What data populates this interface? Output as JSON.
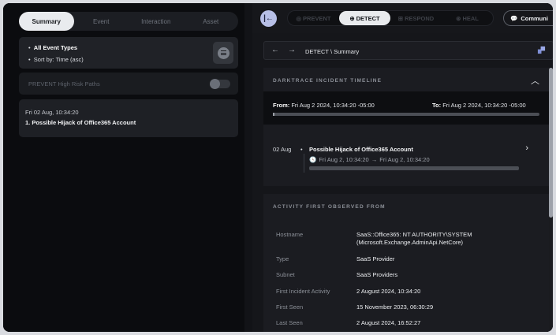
{
  "left_panel": {
    "tabs": [
      {
        "label": "Summary",
        "active": true
      },
      {
        "label": "Event",
        "active": false
      },
      {
        "label": "Interaction",
        "active": false
      },
      {
        "label": "Asset",
        "active": false
      }
    ],
    "filters": {
      "event_types": "All Event Types",
      "sort": "Sort by: Time (asc)",
      "filter_icon": "filter-list-icon"
    },
    "prevent_row": {
      "label": "PREVENT High Risk Paths",
      "enabled": false
    },
    "incident": {
      "date": "Fri 02 Aug, 10:34:20",
      "title": "1. Possible Hijack of Office365 Account"
    }
  },
  "right_panel": {
    "collapse_icon": "collapse-panel-icon",
    "modes": [
      {
        "label": "PREVENT",
        "icon": "prevent-icon",
        "active": false
      },
      {
        "label": "DETECT",
        "icon": "detect-icon",
        "active": true
      },
      {
        "label": "RESPOND",
        "icon": "respond-icon",
        "active": false
      },
      {
        "label": "HEAL",
        "icon": "heal-icon",
        "active": false
      }
    ],
    "communicate_label": "Communi",
    "breadcrumb": "DETECT \\ Summary",
    "timeline": {
      "title": "DARKTRACE INCIDENT TIMELINE",
      "from_label": "From:",
      "from_value": "Fri Aug 2 2024, 10:34:20 -05:00",
      "to_label": "To:",
      "to_value": "Fri Aug 2 2024, 10:34:20 -05:00",
      "event": {
        "date": "02 Aug",
        "title": "Possible Hijack of Office365 Account",
        "start": "Fri Aug 2, 10:34:20",
        "end": "Fri Aug 2, 10:34:20"
      }
    },
    "activity": {
      "title": "ACTIVITY FIRST OBSERVED FROM",
      "rows": [
        {
          "key": "Hostname",
          "value": "SaaS::Office365: NT AUTHORITY\\SYSTEM (Microsoft.Exchange.AdminApi.NetCore)"
        },
        {
          "key": "Type",
          "value": "SaaS Provider"
        },
        {
          "key": "Subnet",
          "value": "SaaS Providers"
        },
        {
          "key": "First Incident Activity",
          "value": "2 August 2024, 10:34:20"
        },
        {
          "key": "First Seen",
          "value": "15 November 2023, 06:30:29"
        },
        {
          "key": "Last Seen",
          "value": "2 August 2024, 16:52:27"
        }
      ]
    }
  },
  "colors": {
    "background": "#0c0d10",
    "panel": "#1b1c21",
    "active_tab": "#e9ebee",
    "accent": "#b7bfe6"
  }
}
